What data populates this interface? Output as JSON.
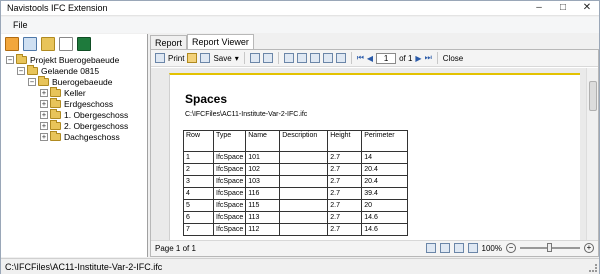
{
  "window": {
    "title": "Navistools IFC Extension",
    "minimize_glyph": "–",
    "maximize_glyph": "□",
    "close_glyph": "✕"
  },
  "menu": {
    "file": "File"
  },
  "tree_toolbar": {
    "icons": [
      "export-icon",
      "report-icon",
      "open-folder-icon",
      "new-document-icon",
      "excel-icon"
    ]
  },
  "tree": {
    "items": [
      {
        "label": "Projekt Buerogebaeude",
        "expander": "−"
      },
      {
        "label": "Gelaende 0815",
        "expander": "−"
      },
      {
        "label": "Buerogebaeude",
        "expander": "−"
      },
      {
        "label": "Keller",
        "expander": "+"
      },
      {
        "label": "Erdgeschoss",
        "expander": "+"
      },
      {
        "label": "1. Obergeschoss",
        "expander": "+"
      },
      {
        "label": "2. Obergeschoss",
        "expander": "+"
      },
      {
        "label": "Dachgeschoss",
        "expander": "+"
      }
    ]
  },
  "tabs": [
    {
      "label": "Report"
    },
    {
      "label": "Report Viewer"
    }
  ],
  "viewer_toolbar": {
    "print": "Print",
    "save": "Save",
    "page_value": "1",
    "of_pages": "of 1",
    "close": "Close"
  },
  "report": {
    "title": "Spaces",
    "path": "C:\\IFCFiles\\AC11-Institute-Var-2-IFC.ifc",
    "columns": [
      "Row",
      "Type",
      "Name",
      "Description",
      "Height",
      "Perimeter"
    ],
    "rows": [
      [
        "1",
        "IfcSpace",
        "101",
        "",
        "2.7",
        "14"
      ],
      [
        "2",
        "IfcSpace",
        "102",
        "",
        "2.7",
        "20.4"
      ],
      [
        "3",
        "IfcSpace",
        "103",
        "",
        "2.7",
        "20.4"
      ],
      [
        "4",
        "IfcSpace",
        "116",
        "",
        "2.7",
        "39.4"
      ],
      [
        "5",
        "IfcSpace",
        "115",
        "",
        "2.7",
        "20"
      ],
      [
        "6",
        "IfcSpace",
        "113",
        "",
        "2.7",
        "14.6"
      ],
      [
        "7",
        "IfcSpace",
        "112",
        "",
        "2.7",
        "14.6"
      ]
    ]
  },
  "viewer_status": {
    "page": "Page 1 of 1",
    "zoom": "100%",
    "zoom_out": "−",
    "zoom_in": "+"
  },
  "statusbar": {
    "text": "C:\\IFCFiles\\AC11-Institute-Var-2-IFC.ifc"
  },
  "colors": {
    "folder": "#e8c45a",
    "page_top_border": "#e3c200",
    "excel_green": "#1e7a3c"
  }
}
